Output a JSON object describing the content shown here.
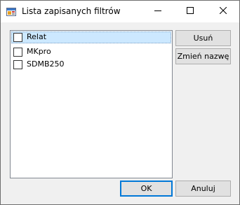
{
  "window": {
    "title": "Lista zapisanych filtrów",
    "app_icon": "dialog-app-icon"
  },
  "titlebar_controls": {
    "minimize_icon": "minimize-icon",
    "maximize_icon": "maximize-icon",
    "close_icon": "close-icon"
  },
  "filters_list": {
    "items": [
      {
        "label": "Relat",
        "checked": false,
        "selected": true
      },
      {
        "label": "MKpro",
        "checked": false,
        "selected": false
      },
      {
        "label": "SDMB250",
        "checked": false,
        "selected": false
      }
    ]
  },
  "buttons": {
    "delete_label": "Usuń",
    "rename_label": "Zmień nazwę",
    "ok_label": "OK",
    "cancel_label": "Anuluj"
  },
  "colors": {
    "selection": "#cce8ff",
    "default_button_border": "#0078d7"
  }
}
